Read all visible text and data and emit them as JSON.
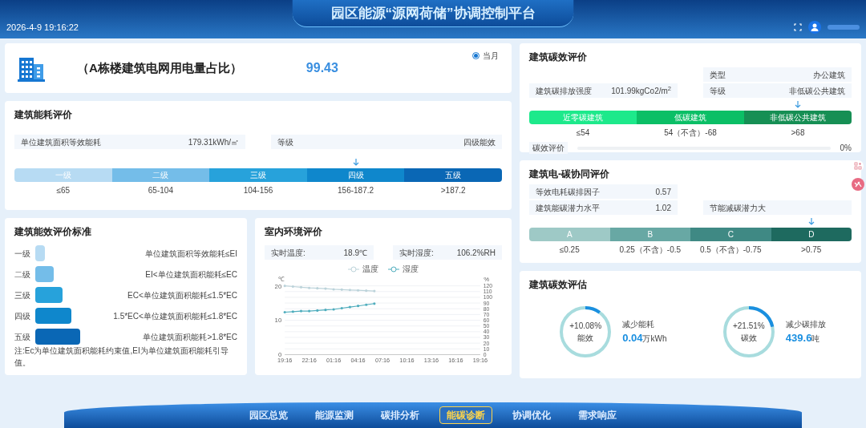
{
  "header": {
    "datetime": "2026-4-9 19:16:22",
    "title": "园区能源“源网荷储”协调控制平台"
  },
  "summary": {
    "title": "（A栋楼建筑电网用电量占比）",
    "value": "99.43",
    "period": {
      "label": "当月",
      "selected": true
    }
  },
  "energy_eval": {
    "title": "建筑能耗评价",
    "fields": [
      {
        "label": "单位建筑面积等效能耗",
        "value": "179.31kWh/㎡"
      },
      {
        "label": "等级",
        "value": "四级能效"
      }
    ],
    "scale": [
      {
        "label": "一级",
        "range": "≤65",
        "color": "#b7dbf3",
        "selected": false
      },
      {
        "label": "二级",
        "range": "65-104",
        "color": "#74bde9",
        "selected": false
      },
      {
        "label": "三级",
        "range": "104-156",
        "color": "#27a2db",
        "selected": false
      },
      {
        "label": "四级",
        "range": "156-187.2",
        "color": "#0f87cc",
        "selected": true
      },
      {
        "label": "五级",
        "range": ">187.2",
        "color": "#0a67b5",
        "selected": false
      }
    ]
  },
  "standard": {
    "title": "建筑能效评价标准",
    "rows": [
      {
        "grade": "一级",
        "color": "#b7dbf3",
        "rule": "单位建筑面积等效能耗≤EI"
      },
      {
        "grade": "二级",
        "color": "#74bde9",
        "rule": "EI<单位建筑面积能耗≤EC"
      },
      {
        "grade": "三级",
        "color": "#27a2db",
        "rule": "EC<单位建筑面积能耗≤1.5*EC"
      },
      {
        "grade": "四级",
        "color": "#0f87cc",
        "rule": "1.5*EC<单位建筑面积能耗≤1.8*EC"
      },
      {
        "grade": "五级",
        "color": "#0a67b5",
        "rule": "单位建筑面积能耗>1.8*EC"
      }
    ],
    "note": "注:Ec为单位建筑面积能耗约束值,EI为单位建筑面积能耗引导值。"
  },
  "indoor": {
    "title": "室内环境评价",
    "readings": [
      {
        "label": "实时温度:",
        "value": "18.9℃"
      },
      {
        "label": "实时湿度:",
        "value": "106.2%RH"
      }
    ],
    "chart_data": {
      "type": "line",
      "ylabel": "℃",
      "y2label": "%",
      "grid": true,
      "categories": [
        "19:16",
        null,
        null,
        "22:16",
        null,
        null,
        "01:16",
        null,
        null,
        "04:16",
        null,
        null,
        "07:16",
        null,
        null,
        "10:16",
        null,
        null,
        "13:16",
        null,
        null,
        "16:16",
        null,
        null,
        "19:16"
      ],
      "ylim": [
        0,
        20
      ],
      "yticks": [
        0,
        10,
        20
      ],
      "y2lim": [
        0,
        120
      ],
      "y2ticks": [
        0,
        10,
        20,
        30,
        40,
        50,
        60,
        70,
        80,
        90,
        100,
        110,
        120
      ],
      "series": [
        {
          "name": "温度",
          "color": "#bcd3da",
          "values": [
            20,
            19.8,
            19.6,
            19.4,
            19.3,
            19.2,
            19.0,
            18.9,
            18.8,
            18.7,
            18.6,
            18.5,
            null,
            null,
            null,
            null,
            null,
            null,
            null,
            null,
            null,
            null,
            null,
            null,
            null
          ]
        },
        {
          "name": "湿度",
          "color": "#4fadbd",
          "axis": "y2",
          "values": [
            74,
            75,
            76,
            76,
            77,
            78,
            79,
            81,
            83,
            85,
            87,
            89,
            null,
            null,
            null,
            null,
            null,
            null,
            null,
            null,
            null,
            null,
            null,
            null,
            null
          ]
        }
      ]
    }
  },
  "carbon_eval": {
    "title": "建筑碳效评价",
    "type": {
      "label": "类型",
      "value": "办公建筑"
    },
    "intensity": {
      "label": "建筑碳排放强度",
      "value": "101.99kgCo2/m$^{2}$"
    },
    "grade": {
      "label": "等级",
      "value": "非低碳公共建筑"
    },
    "scale": [
      {
        "label": "近零碳建筑",
        "range": "≤54",
        "color": "#1de98b",
        "selected": false
      },
      {
        "label": "低碳建筑",
        "range": "54（不含）-68",
        "color": "#0bbf66",
        "selected": false
      },
      {
        "label": "非低碳公共建筑",
        "range": ">68",
        "color": "#168f54",
        "selected": true
      }
    ],
    "progress": {
      "label": "碳效评价",
      "level": 0,
      "reading": "0%"
    }
  },
  "synergy": {
    "title": "建筑电-碳协同评价",
    "fields": [
      {
        "label": "等效电耗碳排因子",
        "value": "0.57"
      },
      {
        "label": "建筑能碳潜力水平",
        "value": "1.02"
      }
    ],
    "conclusion": "节能减碳潜力大",
    "scale": [
      {
        "label": "A",
        "range": "≤0.25",
        "color": "#9ec9c6",
        "selected": false
      },
      {
        "label": "B",
        "range": "0.25（不含）-0.5",
        "color": "#68a8a4",
        "selected": false
      },
      {
        "label": "C",
        "range": "0.5（不含）-0.75",
        "color": "#3f8984",
        "selected": false
      },
      {
        "label": "D",
        "range": ">0.75",
        "color": "#1e6a5f",
        "selected": true
      }
    ]
  },
  "estimate": {
    "title": "建筑碳效评估",
    "items": [
      {
        "percent": "+10.08%",
        "name": "能效",
        "caption": "减少能耗",
        "value": "0.04",
        "unit": "万kWh",
        "level": 0.1008
      },
      {
        "percent": "+21.51%",
        "name": "碳效",
        "caption": "减少碳排放",
        "value": "439.6",
        "unit": "吨",
        "level": 0.2151
      }
    ]
  },
  "nav": [
    {
      "label": "园区总览",
      "selected": false
    },
    {
      "label": "能源监测",
      "selected": false
    },
    {
      "label": "碳排分析",
      "selected": false
    },
    {
      "label": "能碳诊断",
      "selected": true
    },
    {
      "label": "协调优化",
      "selected": false
    },
    {
      "label": "需求响应",
      "selected": false
    }
  ]
}
